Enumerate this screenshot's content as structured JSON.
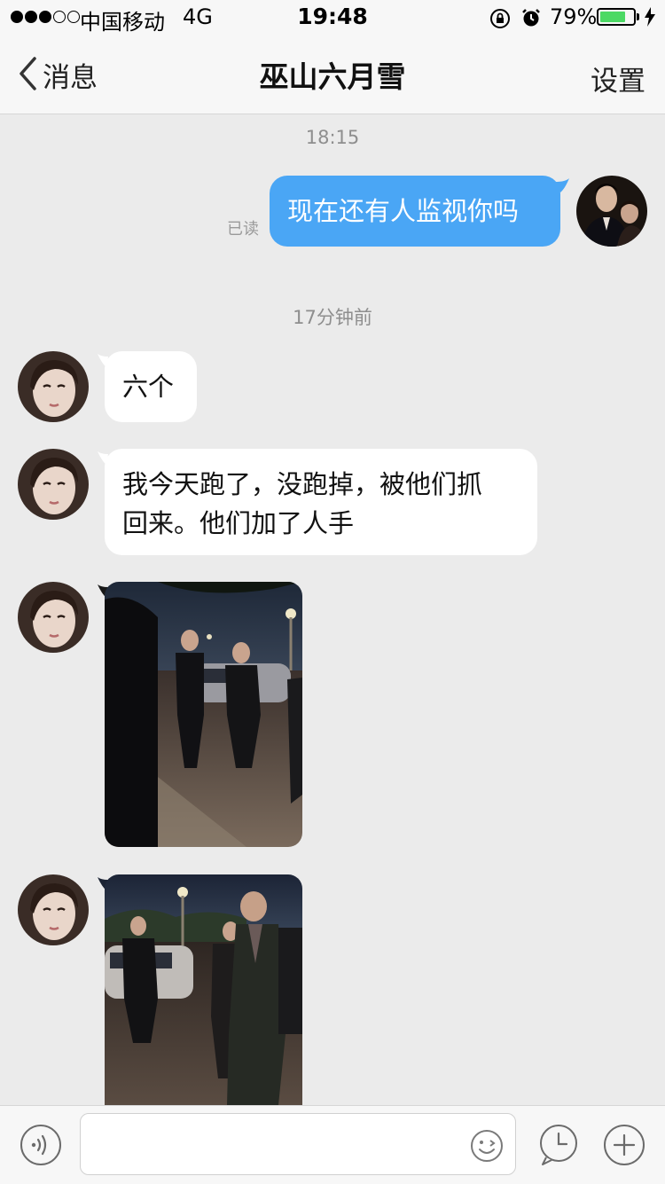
{
  "status_bar": {
    "carrier": "中国移动",
    "network": "4G",
    "time": "19:48",
    "battery_percent": "79%",
    "battery_level": 0.79,
    "signal_bars": 3,
    "battery_color": "#4cd964"
  },
  "nav": {
    "back_label": "消息",
    "title": "巫山六月雪",
    "settings_label": "设置",
    "back_icon": "chevron-left-icon"
  },
  "messages": {
    "time_1": "18:15",
    "outgoing_1": {
      "text": "现在还有人监视你吗",
      "status": "已读",
      "bubble_color": "#4aa6f5"
    },
    "time_2": "17分钟前",
    "incoming_1": {
      "text": "六个"
    },
    "incoming_2": {
      "line1": "我今天跑了，没跑掉，被他们抓",
      "line2": "回来。他们加了人手"
    }
  },
  "input_bar": {
    "placeholder": "",
    "icons": [
      "voice-icon",
      "emoji-icon",
      "clock-icon",
      "plus-icon"
    ]
  }
}
